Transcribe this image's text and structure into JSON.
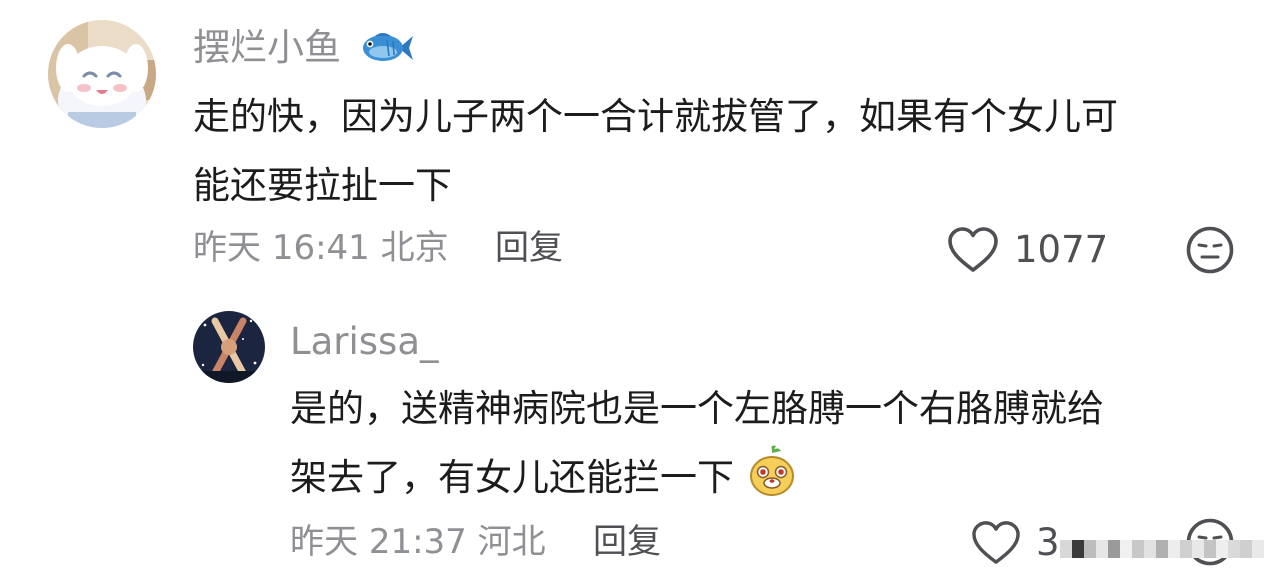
{
  "comment": {
    "author": "摆烂小鱼",
    "author_emoji": "fish-emoji",
    "text_lines": [
      "走的快，因为儿子两个一合计就拔管了，如果有个女儿可",
      "能还要拉扯一下"
    ],
    "date": "昨天",
    "time": "16:41",
    "location": "北京",
    "reply_label": "回复",
    "like_count": "1077",
    "like_icon": "heart-outline-icon",
    "react_icon": "neutral-face-icon"
  },
  "reply": {
    "author": "Larissa_",
    "text_lines": [
      "是的，送精神病院也是一个左胳膊一个右胳膊就给",
      "架去了，有女儿还能拦一下"
    ],
    "text_emoji": "cheeky-face-emoji",
    "date": "昨天",
    "time": "21:37",
    "location": "河北",
    "reply_label": "回复",
    "like_count": "3",
    "like_icon": "heart-outline-icon",
    "react_icon": "neutral-face-icon"
  },
  "colors": {
    "text": "#1c1c1e",
    "meta": "#8f8f94",
    "secondary": "#4f4f54",
    "fish_blue": "#3a8fd4"
  }
}
